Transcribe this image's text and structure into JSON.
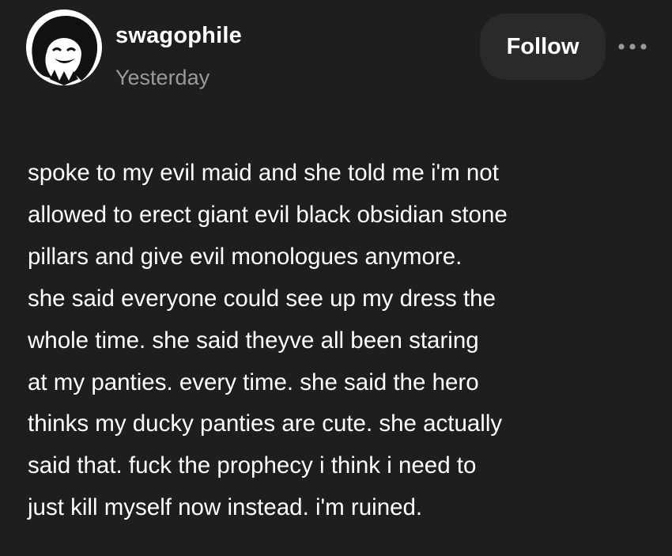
{
  "post": {
    "author": {
      "username": "swagophile",
      "timestamp": "Yesterday",
      "avatar_icon": "avatar-icon"
    },
    "actions": {
      "follow_label": "Follow",
      "more_icon": "ellipsis-icon"
    },
    "body_lines": [
      "spoke to my evil maid and she told me i'm not",
      "allowed to erect giant evil black obsidian stone",
      "pillars and give evil monologues anymore.",
      "she said everyone could see up my dress the",
      "whole time. she said theyve all been staring",
      "at my panties. every time. she said the hero",
      "thinks my ducky panties are cute. she actually",
      "said that. fuck the prophecy i think i need to",
      "just kill myself now instead. i'm ruined."
    ]
  },
  "colors": {
    "background": "#1e1e1e",
    "text": "#ffffff",
    "secondary_text": "#9a9a9a",
    "button_bg": "#2a2a2a"
  }
}
